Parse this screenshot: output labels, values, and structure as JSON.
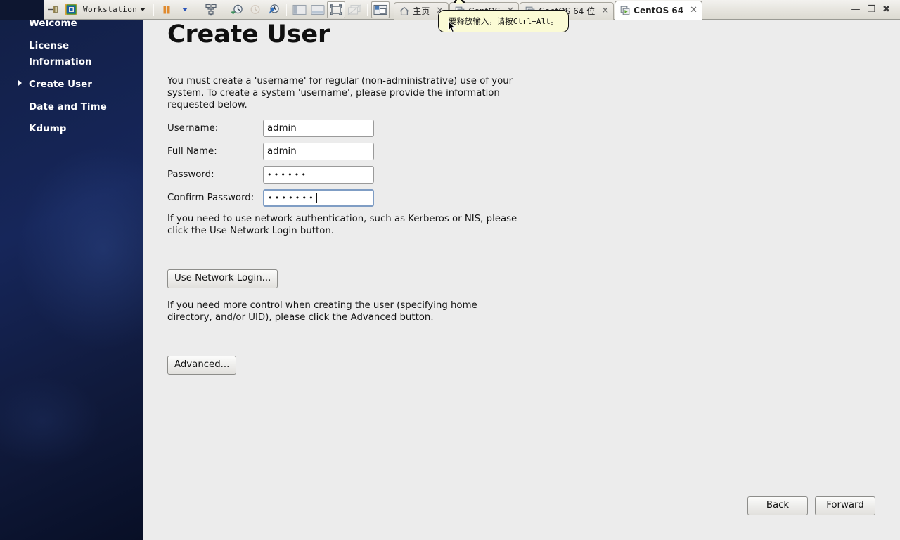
{
  "titlebar": {
    "pin_icon": "pin-icon",
    "app_logo_icon": "vmware-logo-icon",
    "app_menu_label": "Workstation",
    "app_menu_caret_icon": "chevron-down-icon",
    "pause_icon": "pause-icon",
    "power_caret_icon": "chevron-down-blue-icon",
    "toolbar_buttons": [
      {
        "name": "manage-snapshots-icon",
        "label": "manage-snapshots",
        "state": "enabled"
      },
      {
        "name": "take-snapshot-icon",
        "label": "take-snapshot",
        "state": "enabled"
      },
      {
        "name": "revert-snapshot-icon",
        "label": "revert-snapshot",
        "state": "disabled"
      },
      {
        "name": "snapshot-manager-icon",
        "label": "snapshot-manager",
        "state": "enabled"
      },
      {
        "name": "show-library-icon",
        "label": "show-library",
        "state": "enabled"
      },
      {
        "name": "show-thumbnails-icon",
        "label": "show-thumbnail-bar",
        "state": "enabled"
      },
      {
        "name": "fullscreen-icon",
        "label": "enter-full-screen",
        "state": "active"
      },
      {
        "name": "unity-mode-icon",
        "label": "unity-mode",
        "state": "disabled"
      },
      {
        "name": "console-view-icon",
        "label": "console-view",
        "state": "active"
      }
    ],
    "tabs": [
      {
        "title": "主页",
        "icon": "home-icon",
        "active": false,
        "closable": true
      },
      {
        "title": "CentOS",
        "icon": "vm-icon",
        "active": false,
        "closable": true
      },
      {
        "title": "CentOS 64 位",
        "icon": "vm-suspended-icon",
        "active": false,
        "closable": true
      },
      {
        "title": "CentOS 64",
        "icon": "vm-running-icon",
        "active": true,
        "closable": true
      }
    ],
    "tab_close_glyph": "✕",
    "window_buttons": [
      {
        "name": "minimize-button",
        "glyph": "—"
      },
      {
        "name": "restore-button",
        "glyph": "❐"
      },
      {
        "name": "close-button",
        "glyph": "✖"
      }
    ]
  },
  "tooltip": {
    "text_prefix": "要释放输入，请按 ",
    "keys": "Ctrl+Alt",
    "text_suffix": "。"
  },
  "guest": {
    "sidebar": {
      "items": [
        {
          "label": "Welcome",
          "current": false
        },
        {
          "label": "License Information",
          "current": false
        },
        {
          "label": "Create User",
          "current": true
        },
        {
          "label": "Date and Time",
          "current": false
        },
        {
          "label": "Kdump",
          "current": false
        }
      ]
    },
    "page_title": "Create User",
    "paragraphs": {
      "intro": "You must create a 'username' for regular (non-administrative) use of your system.  To create a system 'username', please provide the information requested below.",
      "network": "If you need to use network authentication, such as Kerberos or NIS, please click the Use Network Login button.",
      "advanced": "If you need more control when creating the user (specifying home directory, and/or UID), please click the Advanced button."
    },
    "form": {
      "username": {
        "label": "Username:",
        "value": "admin",
        "placeholder": "",
        "focused": false
      },
      "fullname": {
        "label": "Full Name:",
        "value": "admin",
        "placeholder": "",
        "focused": false
      },
      "password": {
        "label": "Password:",
        "masked_value": "••••••",
        "focused": false
      },
      "confirm": {
        "label": "Confirm Password:",
        "masked_value": "•••••••",
        "focused": true
      }
    },
    "buttons": {
      "network_login": "Use Network Login...",
      "advanced": "Advanced...",
      "back": "Back",
      "forward": "Forward"
    }
  },
  "colors": {
    "sidebar_navy_dark": "#080f26",
    "sidebar_navy_mid": "#16265a",
    "pane_background": "#ececec",
    "tooltip_background": "#fbfbd5",
    "focus_border": "#7f9dc4",
    "accent_orange": "#e08a2e",
    "accent_green": "#5fa832"
  }
}
